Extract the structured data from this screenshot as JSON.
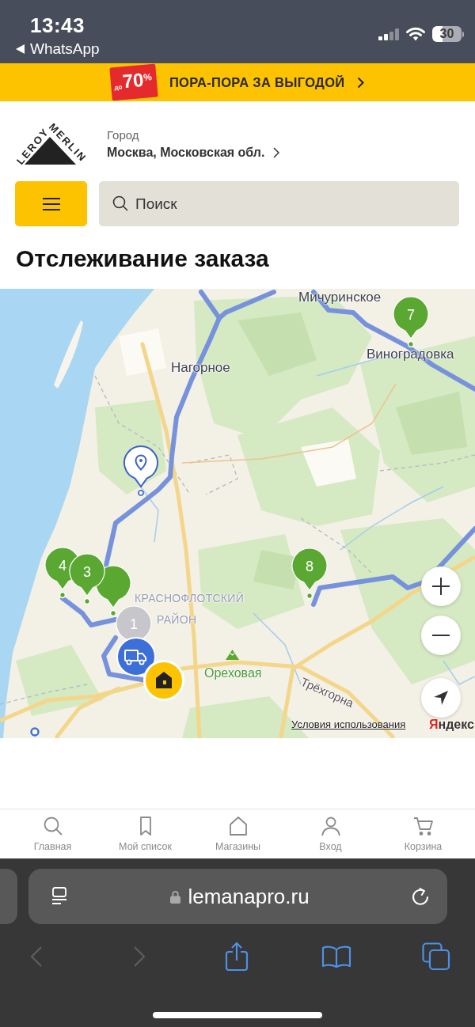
{
  "status_bar": {
    "time": "13:43",
    "back_app": "WhatsApp",
    "battery": "30"
  },
  "promo_banner": {
    "badge": "$_{до}$70$^{%}$",
    "text": "ПОРА-ПОРА ЗА ВЫГОДОЙ"
  },
  "header": {
    "logo": {
      "line_1": "LEROY",
      "line_2": "MERLIN"
    },
    "city_label": "Город",
    "city": "Москва, Московская обл.",
    "search": {
      "placeholder": "Поиск"
    }
  },
  "page_title": "Отслеживание заказа",
  "map": {
    "place_labels": [
      {
        "text": "Мичуринское",
        "kind": "village"
      },
      {
        "text": "Виноградовка",
        "kind": "village"
      },
      {
        "text": "Нагорное",
        "kind": "village"
      },
      {
        "text": "КРАСНОФЛОТСКИЙ",
        "kind": "district"
      },
      {
        "text": "РАЙОН",
        "kind": "district"
      },
      {
        "text": "Ореховая",
        "kind": "peak"
      },
      {
        "text": "Трёхгорна",
        "kind": "street"
      }
    ],
    "markers": [
      {
        "kind": "stop",
        "label": "7",
        "color": "#5aa832"
      },
      {
        "kind": "location"
      },
      {
        "kind": "stop",
        "label": "4",
        "color": "#5aa832"
      },
      {
        "kind": "stop",
        "label": "3",
        "color": "#5aa832"
      },
      {
        "kind": "stop",
        "color": "#5aa832"
      },
      {
        "kind": "stop",
        "label": "8",
        "color": "#5aa832"
      },
      {
        "kind": "stop",
        "label": "1",
        "color": "#c6c6cb"
      },
      {
        "kind": "vehicle"
      },
      {
        "kind": "home"
      }
    ],
    "terms_link": "Условия использования",
    "provider": "Яндекс"
  },
  "bottom_nav": [
    {
      "label": "Главная"
    },
    {
      "label": "Мой список"
    },
    {
      "label": "Магазины"
    },
    {
      "label": "Вход"
    },
    {
      "label": "Корзина"
    }
  ],
  "browser": {
    "url": "lemanapro.ru",
    "toolbar": [
      {
        "disabled": true
      },
      {
        "disabled": true
      },
      {
        "disabled": false
      },
      {
        "disabled": false
      },
      {
        "disabled": false
      }
    ]
  }
}
